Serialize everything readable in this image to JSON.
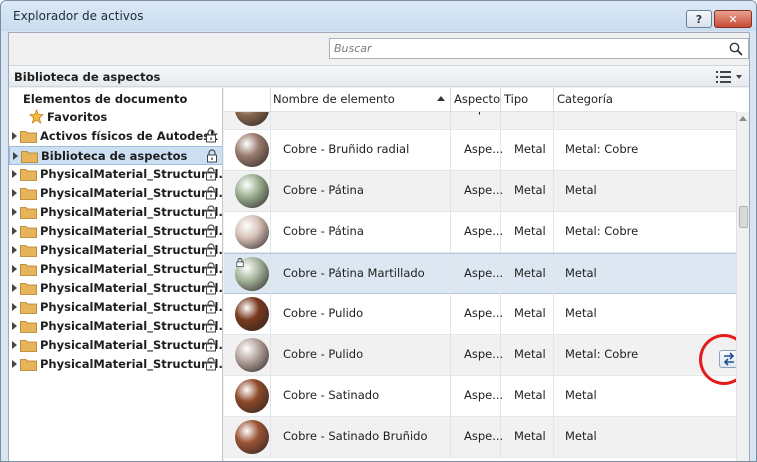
{
  "window": {
    "title": "Explorador de activos",
    "help_label": "?",
    "close_label": "✕"
  },
  "search": {
    "placeholder": "Buscar"
  },
  "library": {
    "title": "Biblioteca de aspectos"
  },
  "tree": {
    "items": [
      {
        "label": "Elementos de documento"
      },
      {
        "label": "Favoritos"
      },
      {
        "label": "Activos físicos de Autodesk"
      },
      {
        "label": "Biblioteca de aspectos"
      },
      {
        "label": "PhysicalMaterial_Structural..."
      },
      {
        "label": "PhysicalMaterial_Structural..."
      },
      {
        "label": "PhysicalMaterial_Structural..."
      },
      {
        "label": "PhysicalMaterial_Structural..."
      },
      {
        "label": "PhysicalMaterial_Structural..."
      },
      {
        "label": "PhysicalMaterial_Structural..."
      },
      {
        "label": "PhysicalMaterial_Structural..."
      },
      {
        "label": "PhysicalMaterial_Structural..."
      },
      {
        "label": "PhysicalMaterial_Structural..."
      },
      {
        "label": "PhysicalMaterial_Structural..."
      },
      {
        "label": "PhysicalMaterial_Structural..."
      }
    ]
  },
  "table": {
    "columns": {
      "name": "Nombre de elemento",
      "aspect": "Aspecto",
      "type": "Tipo",
      "category": "Categoría"
    },
    "rows": [
      {
        "name": "Cobre",
        "aspect": "Aspe...",
        "type": "Genér...",
        "category": "Metal",
        "color": "#8a6a52"
      },
      {
        "name": "Cobre - Bruñido radial",
        "aspect": "Aspe...",
        "type": "Metal",
        "category": "Metal: Cobre",
        "color": "#9b7c70"
      },
      {
        "name": "Cobre - Pátina",
        "aspect": "Aspe...",
        "type": "Metal",
        "category": "Metal",
        "color": "#9cb193"
      },
      {
        "name": "Cobre - Pátina",
        "aspect": "Aspe...",
        "type": "Metal",
        "category": "Metal: Cobre",
        "color": "#d8c2b9"
      },
      {
        "name": "Cobre - Pátina Martillado",
        "aspect": "Aspe...",
        "type": "Metal",
        "category": "Metal",
        "color": "#a9b9a0"
      },
      {
        "name": "Cobre - Pulido",
        "aspect": "Aspe...",
        "type": "Metal",
        "category": "Metal",
        "color": "#7a3a1e"
      },
      {
        "name": "Cobre - Pulido",
        "aspect": "Aspe...",
        "type": "Metal",
        "category": "Metal: Cobre",
        "color": "#b7a6a0"
      },
      {
        "name": "Cobre - Satinado",
        "aspect": "Aspe...",
        "type": "Metal",
        "category": "Metal",
        "color": "#8e4a2a"
      },
      {
        "name": "Cobre - Satinado Bruñido",
        "aspect": "Aspe...",
        "type": "Metal",
        "category": "Metal",
        "color": "#9a5334"
      }
    ]
  }
}
